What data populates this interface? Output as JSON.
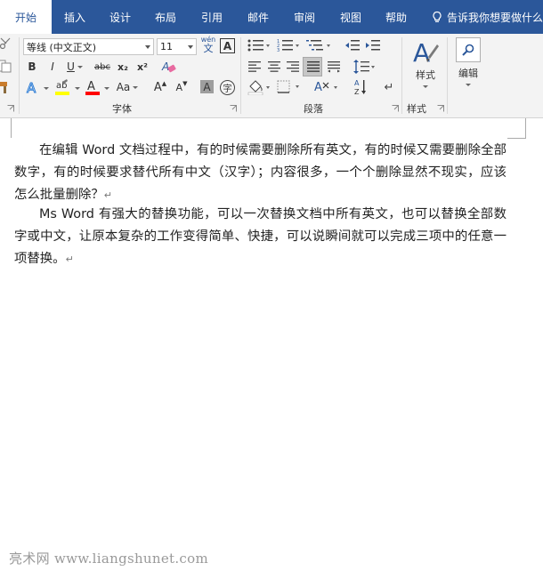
{
  "tabs": [
    {
      "label": "开始",
      "active": true
    },
    {
      "label": "插入"
    },
    {
      "label": "设计"
    },
    {
      "label": "布局"
    },
    {
      "label": "引用"
    },
    {
      "label": "邮件"
    },
    {
      "label": "审阅"
    },
    {
      "label": "视图"
    },
    {
      "label": "帮助"
    }
  ],
  "tell_me": "告诉我你想要做什么",
  "font": {
    "name": "等线 (中文正文)",
    "size": "11",
    "group_label": "字体",
    "bold": "B",
    "italic": "I",
    "underline": "U",
    "strike": "abc",
    "subscript": "x₂",
    "superscript": "x²",
    "grow": "A",
    "shrink": "A",
    "case": "Aa",
    "phonetic_top": "wén",
    "phonetic_bottom": "文",
    "border_char": "A",
    "shade_char": "A",
    "enclose_char": "字",
    "highlight_color": "#ffff00",
    "font_color": "#ff0000"
  },
  "paragraph": {
    "group_label": "段落",
    "sort": "AZ"
  },
  "styles": {
    "group_label": "样式",
    "button_label": "样式"
  },
  "editing": {
    "button_label": "编辑"
  },
  "document": {
    "paragraphs": [
      "在编辑 Word 文档过程中，有的时候需要删除所有英文，有的时候又需要删除全部数字，有的时候要求替代所有中文（汉字）；内容很多，一个个删除显然不现实，应该怎么批量删除？",
      "Ms Word 有强大的替换功能，可以一次替换文档中所有英文，也可以替换全部数字或中文，让原本复杂的工作变得简单、快捷，可以说瞬间就可以完成三项中的任意一项替换。"
    ],
    "line_break_mark": "↵",
    "para_mark": "↵"
  },
  "watermark": "亮术网 www.liangshunet.com",
  "colors": {
    "ribbon_blue": "#2b579a",
    "ribbon_bg": "#f3f3f3"
  }
}
